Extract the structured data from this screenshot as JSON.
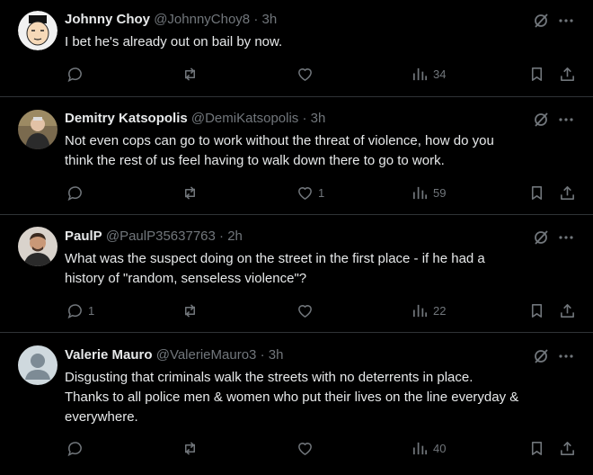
{
  "tweets": [
    {
      "name": "Johnny Choy",
      "handle": "@JohnnyChoy8",
      "dot": "·",
      "time": "3h",
      "lines": [
        "I bet he's already out on bail by now."
      ],
      "replies": "",
      "retweets": "",
      "likes": "",
      "views": "34",
      "avatar": "cartoon-face"
    },
    {
      "name": "Demitry Katsopolis",
      "handle": "@DemiKatsopolis",
      "dot": "·",
      "time": "3h",
      "lines": [
        "Not even cops can go to work without the threat of violence, how do you",
        "think the rest of us feel having to walk down there to go to work."
      ],
      "replies": "",
      "retweets": "",
      "likes": "1",
      "views": "59",
      "avatar": "photo"
    },
    {
      "name": "PaulP",
      "handle": "@PaulP35637763",
      "dot": "·",
      "time": "2h",
      "lines": [
        "What was the suspect doing on the street in the first place - if he had a",
        "history of \"random, senseless violence\"?"
      ],
      "replies": "1",
      "retweets": "",
      "likes": "",
      "views": "22",
      "avatar": "photo"
    },
    {
      "name": "Valerie Mauro",
      "handle": "@ValerieMauro3",
      "dot": "·",
      "time": "3h",
      "lines": [
        "Disgusting that criminals walk the streets with no deterrents in place.",
        "Thanks to all police men & women who put their lives on the line everyday &",
        "everywhere."
      ],
      "replies": "",
      "retweets": "",
      "likes": "",
      "views": "40",
      "avatar": "default-silhouette"
    }
  ],
  "colors": {
    "background": "#000000",
    "text": "#e7e9ea",
    "muted": "#71767b",
    "divider": "#2f3336"
  },
  "icons": [
    "reply-icon",
    "retweet-icon",
    "like-icon",
    "views-icon",
    "bookmark-icon",
    "share-icon",
    "grok-icon",
    "more-icon"
  ]
}
